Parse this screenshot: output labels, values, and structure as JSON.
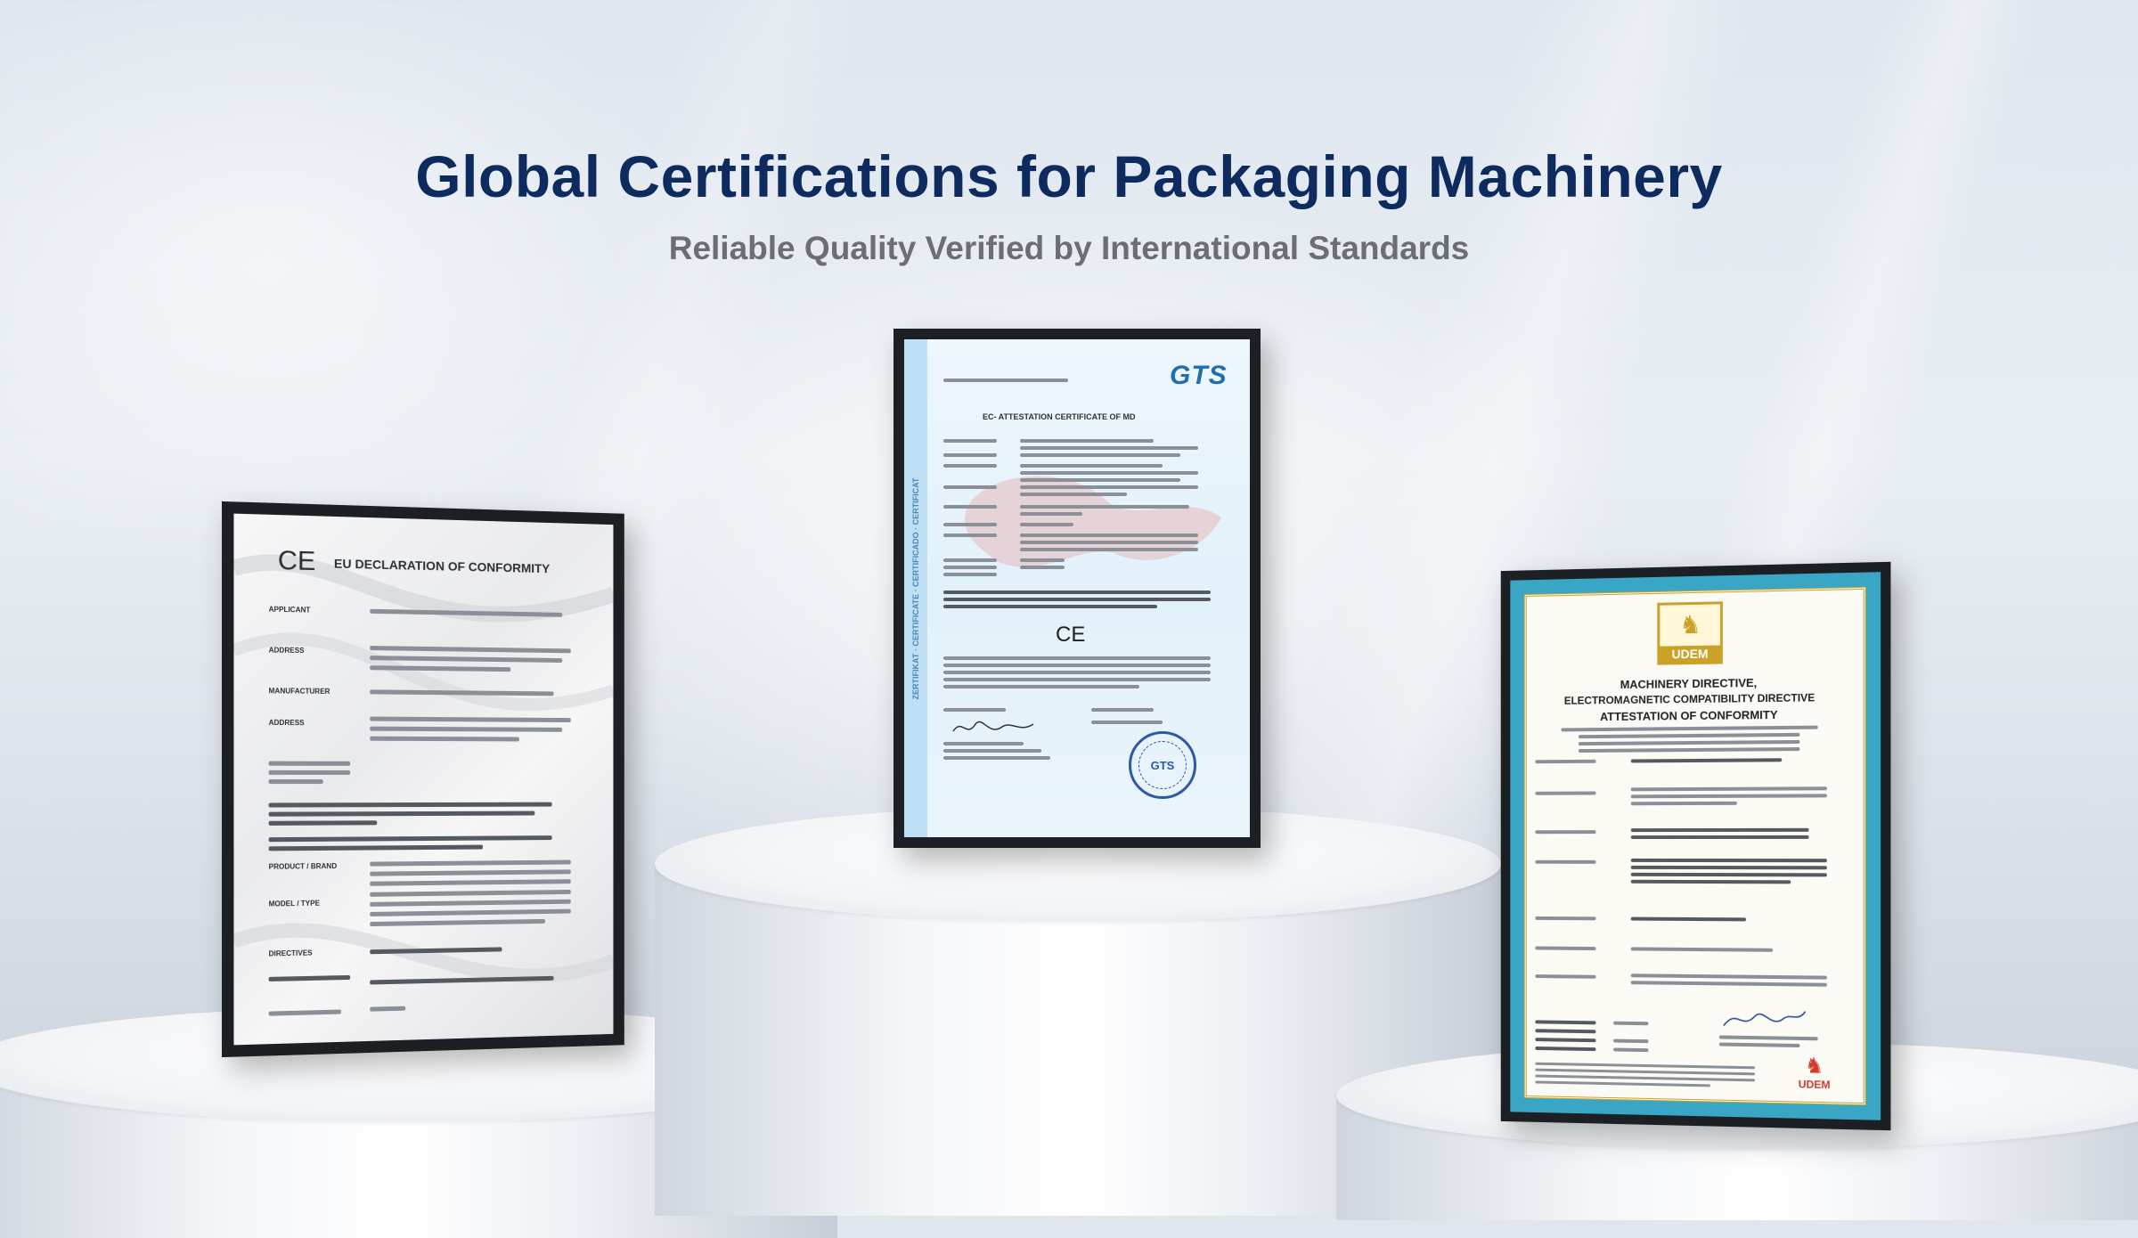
{
  "header": {
    "title": "Global Certifications for Packaging Machinery",
    "subtitle": "Reliable Quality Verified by International Standards"
  },
  "certificates": {
    "left": {
      "mark": "CE",
      "heading": "EU DECLARATION OF CONFORMITY",
      "fields": [
        "APPLICANT",
        "ADDRESS",
        "MANUFACTURER",
        "ADDRESS",
        "PRODUCT / BRAND",
        "MODEL / TYPE",
        "DIRECTIVES"
      ]
    },
    "center": {
      "logo": "GTS",
      "heading": "EC- ATTESTATION CERTIFICATE OF MD",
      "mark": "CE",
      "side_text": "ZERTIFIKAT · CERTIFICATE · CERTIFICADO · CERTIFICAT",
      "seal": "GTS"
    },
    "right": {
      "logo": "UDEM",
      "heading_lines": [
        "MACHINERY DIRECTIVE,",
        "ELECTROMAGNETIC COMPATIBILITY DIRECTIVE",
        "ATTESTATION OF CONFORMITY"
      ],
      "footer_logo": "UDEM"
    }
  },
  "colors": {
    "title": "#0d2b5f",
    "subtitle": "#6b6f74",
    "frame": "#1c1f24",
    "udem_border": "#3aa6c6",
    "udem_gold": "#c9a227",
    "gts_blue": "#1e6fb3"
  }
}
